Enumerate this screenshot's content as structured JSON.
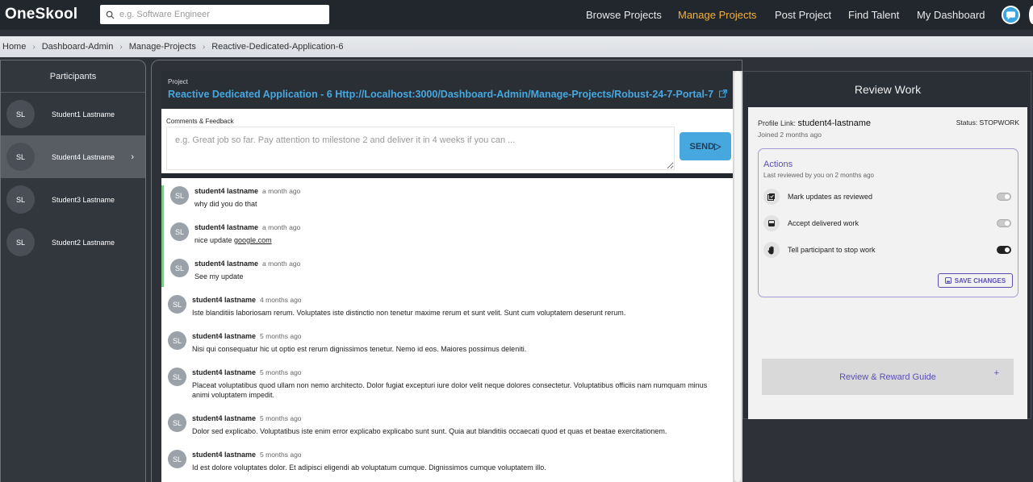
{
  "header": {
    "logo": "OneSkool",
    "search_placeholder": "e.g. Software Engineer",
    "nav": [
      {
        "label": "Browse Projects",
        "active": false
      },
      {
        "label": "Manage Projects",
        "active": true
      },
      {
        "label": "Post Project",
        "active": false
      },
      {
        "label": "Find Talent",
        "active": false
      },
      {
        "label": "My Dashboard",
        "active": false
      }
    ]
  },
  "breadcrumb": [
    "Home",
    "Dashboard-Admin",
    "Manage-Projects",
    "Reactive-Dedicated-Application-6"
  ],
  "participants": {
    "title": "Participants",
    "items": [
      {
        "initials": "SL",
        "name": "Student1 Lastname"
      },
      {
        "initials": "SL",
        "name": "Student4 Lastname"
      },
      {
        "initials": "SL",
        "name": "Student3 Lastname"
      },
      {
        "initials": "SL",
        "name": "Student2 Lastname"
      }
    ]
  },
  "project": {
    "label": "Project",
    "title": "Reactive Dedicated Application - 6 Http://Localhost:3000/Dashboard-Admin/Manage-Projects/Robust-24-7-Portal-7"
  },
  "comments": {
    "label": "Comments & Feedback",
    "placeholder": "e.g. Great job so far. Pay attention to milestone 2 and deliver it in 4 weeks if you can ...",
    "send_label": "SEND"
  },
  "messages": [
    {
      "initials": "SL",
      "author": "student4 lastname",
      "time": "a month ago",
      "text": "why did you do that"
    },
    {
      "initials": "SL",
      "author": "student4 lastname",
      "time": "a month ago",
      "text": "nice update ",
      "link": "google.com"
    },
    {
      "initials": "SL",
      "author": "student4 lastname",
      "time": "a month ago",
      "text": "See my update"
    },
    {
      "initials": "SL",
      "author": "student4 lastname",
      "time": "4 months ago",
      "text": "Iste blanditiis laboriosam rerum. Voluptates iste distinctio non tenetur maxime rerum et sunt velit. Sunt cum voluptatem deserunt rerum."
    },
    {
      "initials": "SL",
      "author": "student4 lastname",
      "time": "5 months ago",
      "text": "Nisi qui consequatur hic ut optio est rerum dignissimos tenetur. Nemo id eos. Maiores possimus deleniti."
    },
    {
      "initials": "SL",
      "author": "student4 lastname",
      "time": "5 months ago",
      "text": "Placeat voluptatibus quod ullam non nemo architecto. Dolor fugiat excepturi iure dolor velit neque dolores consectetur. Voluptatibus officiis nam numquam minus animi voluptatem impedit."
    },
    {
      "initials": "SL",
      "author": "student4 lastname",
      "time": "5 months ago",
      "text": "Dolor sed explicabo. Voluptatibus iste enim error explicabo explicabo sunt sunt. Quia aut blanditiis occaecati quod et quas et beatae exercitationem."
    },
    {
      "initials": "SL",
      "author": "student4 lastname",
      "time": "5 months ago",
      "text": "Id est dolore voluptates dolor. Et adipisci eligendi ab voluptatum cumque. Dignissimos cumque voluptatem illo."
    }
  ],
  "review": {
    "title": "Review Work",
    "profile_link_label": "Profile Link:",
    "profile_link_value": "student4-lastname",
    "joined": "Joined 2 months ago",
    "status": "Status: STOPWORK",
    "actions_title": "Actions",
    "actions_sub": "Last reviewed by you on 2 months ago",
    "actions": [
      {
        "label": "Mark updates as reviewed",
        "icon": "checklist-icon",
        "on": false
      },
      {
        "label": "Accept delivered work",
        "icon": "inbox-icon",
        "on": false
      },
      {
        "label": "Tell participant to stop work",
        "icon": "hand-icon",
        "on": true
      }
    ],
    "save_label": "SAVE CHANGES",
    "guide_label": "Review & Reward Guide",
    "guide_plus": "+"
  }
}
